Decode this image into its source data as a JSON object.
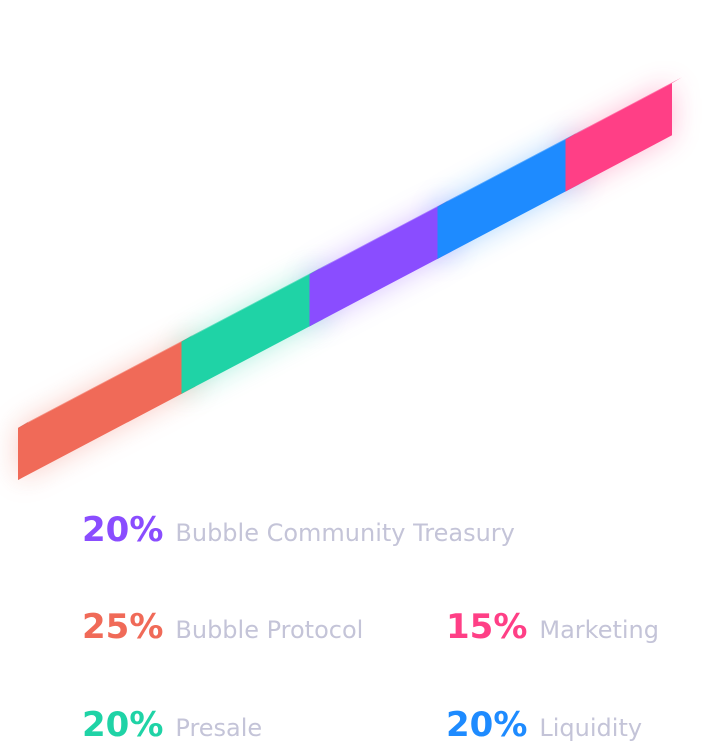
{
  "chart_data": {
    "type": "bar",
    "categories": [
      "Bubble Protocol",
      "Presale",
      "Bubble Community Treasury",
      "Liquidity",
      "Marketing"
    ],
    "values": [
      25,
      20,
      20,
      20,
      15
    ],
    "unit": "%",
    "colors": [
      "#f06a58",
      "#1fd3a6",
      "#8a4dff",
      "#1e8bff",
      "#ff3f86"
    ]
  },
  "legend": {
    "treasury": {
      "value": "20%",
      "label": "Bubble Community Treasury",
      "color": "#8a4dff"
    },
    "protocol": {
      "value": "25%",
      "label": "Bubble Protocol",
      "color": "#f06a58"
    },
    "marketing": {
      "value": "15%",
      "label": "Marketing",
      "color": "#ff3f86"
    },
    "presale": {
      "value": "20%",
      "label": "Presale",
      "color": "#1fd3a6"
    },
    "liquidity": {
      "value": "20%",
      "label": "Liquidity",
      "color": "#1e8bff"
    }
  }
}
